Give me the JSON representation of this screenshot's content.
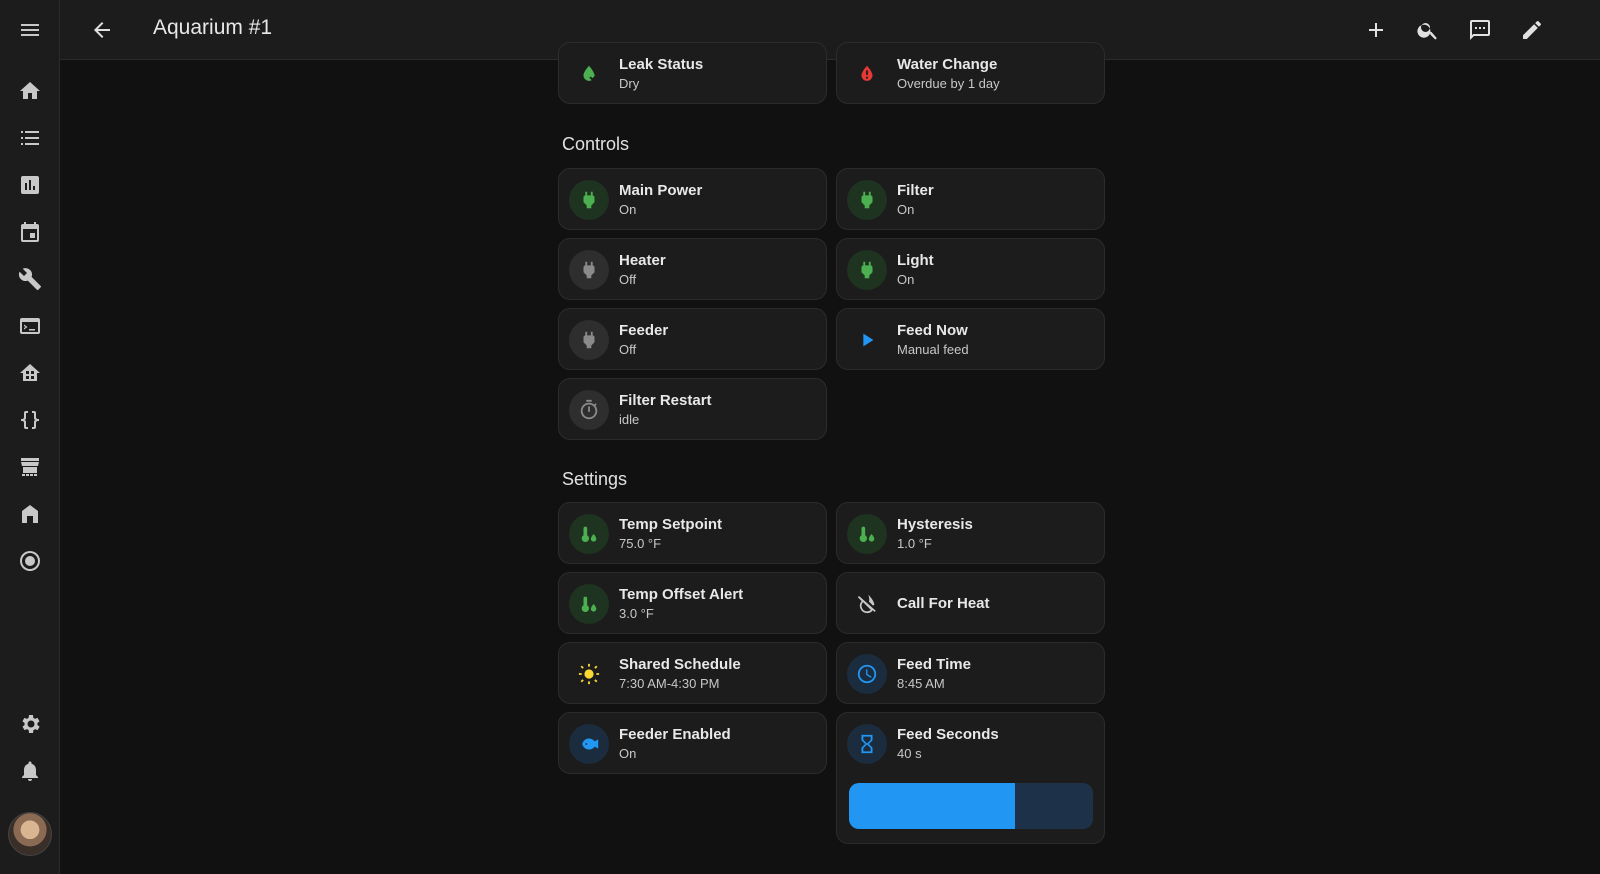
{
  "header": {
    "title": "Aquarium #1"
  },
  "sidebar": {
    "items": [
      "overview",
      "logbook",
      "history",
      "calendar",
      "developer-tools",
      "terminal",
      "energy",
      "code",
      "hacs",
      "home",
      "media"
    ],
    "bottom": [
      "settings",
      "notifications",
      "profile"
    ]
  },
  "status": {
    "leak": {
      "name": "Leak Status",
      "state": "Dry"
    },
    "water_change": {
      "name": "Water Change",
      "state": "Overdue by 1 day"
    }
  },
  "controls": {
    "title": "Controls",
    "main_power": {
      "name": "Main Power",
      "state": "On"
    },
    "filter": {
      "name": "Filter",
      "state": "On"
    },
    "heater": {
      "name": "Heater",
      "state": "Off"
    },
    "light": {
      "name": "Light",
      "state": "On"
    },
    "feeder": {
      "name": "Feeder",
      "state": "Off"
    },
    "feed_now": {
      "name": "Feed Now",
      "state": "Manual feed"
    },
    "filter_restart": {
      "name": "Filter Restart",
      "state": "idle"
    }
  },
  "settings": {
    "title": "Settings",
    "temp_setpoint": {
      "name": "Temp Setpoint",
      "state": "75.0 °F"
    },
    "hysteresis": {
      "name": "Hysteresis",
      "state": "1.0 °F"
    },
    "temp_offset_alert": {
      "name": "Temp Offset Alert",
      "state": "3.0 °F"
    },
    "call_for_heat": {
      "name": "Call For Heat"
    },
    "shared_schedule": {
      "name": "Shared Schedule",
      "state": "7:30 AM-4:30 PM"
    },
    "feed_time": {
      "name": "Feed Time",
      "state": "8:45 AM"
    },
    "feeder_enabled": {
      "name": "Feeder Enabled",
      "state": "On"
    },
    "feed_seconds": {
      "name": "Feed Seconds",
      "state": "40 s",
      "slider_fraction": 0.68
    }
  },
  "colors": {
    "accent_blue": "#2196f3",
    "on_green": "#4caf50",
    "alert_red": "#e53935",
    "sun_yellow": "#fdd835"
  }
}
